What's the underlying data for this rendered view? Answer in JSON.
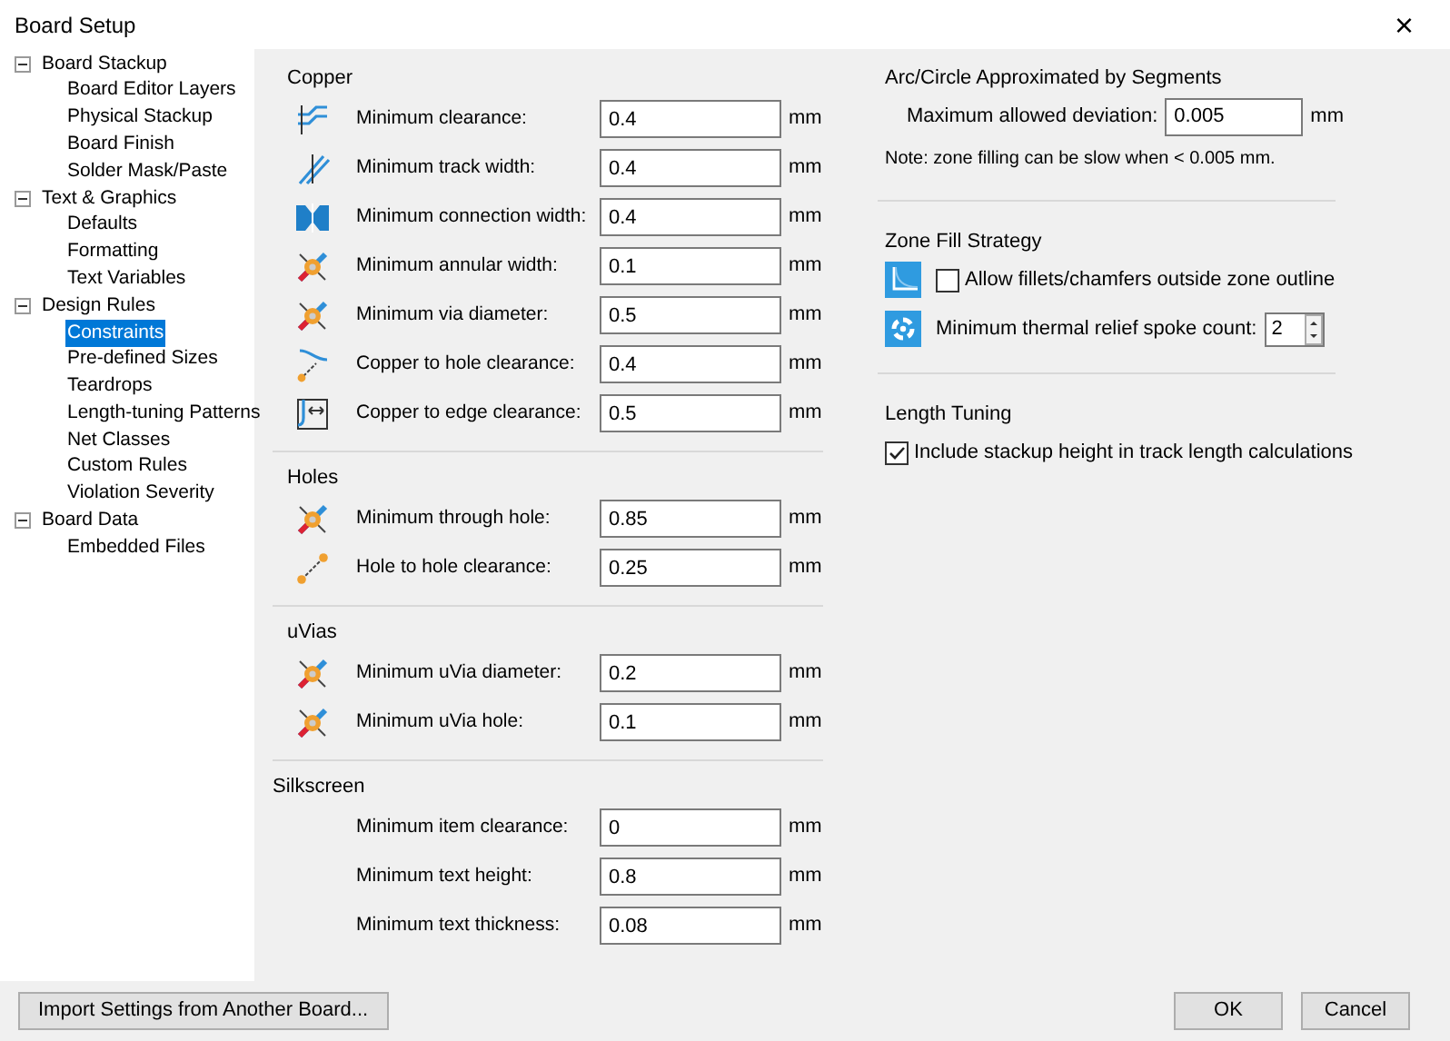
{
  "window": {
    "title": "Board Setup",
    "close": "×"
  },
  "tree": [
    {
      "label": "Board Stackup",
      "expanded": true,
      "selected": false,
      "children": [
        {
          "label": "Board Editor Layers",
          "selected": false
        },
        {
          "label": "Physical Stackup",
          "selected": false
        },
        {
          "label": "Board Finish",
          "selected": false
        },
        {
          "label": "Solder Mask/Paste",
          "selected": false
        }
      ]
    },
    {
      "label": "Text & Graphics",
      "expanded": true,
      "selected": false,
      "children": [
        {
          "label": "Defaults",
          "selected": false
        },
        {
          "label": "Formatting",
          "selected": false
        },
        {
          "label": "Text Variables",
          "selected": false
        }
      ]
    },
    {
      "label": "Design Rules",
      "expanded": true,
      "selected": false,
      "children": [
        {
          "label": "Constraints",
          "selected": true
        },
        {
          "label": "Pre-defined Sizes",
          "selected": false
        },
        {
          "label": "Teardrops",
          "selected": false
        },
        {
          "label": "Length-tuning Patterns",
          "selected": false
        },
        {
          "label": "Net Classes",
          "selected": false
        },
        {
          "label": "Custom Rules",
          "selected": false
        },
        {
          "label": "Violation Severity",
          "selected": false
        }
      ]
    },
    {
      "label": "Board Data",
      "expanded": true,
      "selected": false,
      "children": [
        {
          "label": "Embedded Files",
          "selected": false
        }
      ]
    }
  ],
  "sections": [
    {
      "title": "Copper",
      "rows": [
        {
          "label": "Minimum clearance:",
          "value": "0.4",
          "unit": "mm"
        },
        {
          "label": "Minimum track width:",
          "value": "0.4",
          "unit": "mm"
        },
        {
          "label": "Minimum connection width:",
          "value": "0.4",
          "unit": "mm"
        },
        {
          "label": "Minimum annular width:",
          "value": "0.1",
          "unit": "mm"
        },
        {
          "label": "Minimum via diameter:",
          "value": "0.5",
          "unit": "mm"
        },
        {
          "label": "Copper to hole clearance:",
          "value": "0.4",
          "unit": "mm"
        },
        {
          "label": "Copper to edge clearance:",
          "value": "0.5",
          "unit": "mm"
        }
      ]
    },
    {
      "title": "Holes",
      "rows": [
        {
          "label": "Minimum through hole:",
          "value": "0.85",
          "unit": "mm"
        },
        {
          "label": "Hole to hole clearance:",
          "value": "0.25",
          "unit": "mm"
        }
      ]
    },
    {
      "title": "uVias",
      "rows": [
        {
          "label": "Minimum uVia diameter:",
          "value": "0.2",
          "unit": "mm"
        },
        {
          "label": "Minimum uVia hole:",
          "value": "0.1",
          "unit": "mm"
        }
      ]
    },
    {
      "title": "Silkscreen",
      "rows": [
        {
          "label": "Minimum item clearance:",
          "value": "0",
          "unit": "mm"
        },
        {
          "label": "Minimum text height:",
          "value": "0.8",
          "unit": "mm"
        },
        {
          "label": "Minimum text thickness:",
          "value": "0.08",
          "unit": "mm"
        }
      ]
    }
  ],
  "arc": {
    "title": "Arc/Circle Approximated by Segments",
    "label": "Maximum allowed deviation:",
    "value": "0.005",
    "unit": "mm",
    "note": "Note: zone filling can be slow when < 0.005 mm."
  },
  "zone_fill": {
    "title": "Zone Fill Strategy",
    "fillets": {
      "label": "Allow fillets/chamfers outside zone outline",
      "checked": false
    },
    "spokes": {
      "label": "Minimum thermal relief spoke count:",
      "value": "2"
    }
  },
  "length_tuning": {
    "title": "Length Tuning",
    "stackup": {
      "label": "Include stackup height in track length calculations",
      "checked": true
    }
  },
  "buttons": {
    "import": "Import Settings from Another Board...",
    "ok": "OK",
    "cancel": "Cancel"
  }
}
